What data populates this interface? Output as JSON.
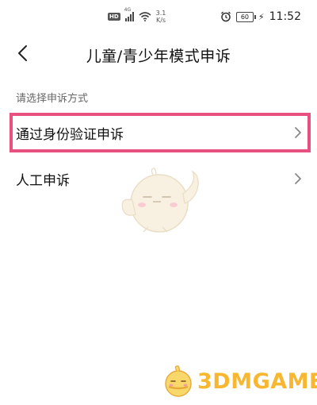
{
  "status_bar": {
    "hd_badge": "HD",
    "network_tag": "4G",
    "speed_value": "3.1",
    "speed_unit": "K/s",
    "battery_level": "60",
    "time": "11:52"
  },
  "nav": {
    "title": "儿童/青少年模式申诉",
    "back_icon": "chevron-left-icon"
  },
  "section": {
    "caption": "请选择申诉方式"
  },
  "options": [
    {
      "label": "通过身份验证申诉",
      "icon": "chevron-right-icon",
      "highlighted": true
    },
    {
      "label": "人工申诉",
      "icon": "chevron-right-icon",
      "highlighted": false
    }
  ],
  "watermark": {
    "text": "3DMGAME"
  },
  "colors": {
    "highlight_border": "#e8517f",
    "watermark": "#f7b731"
  }
}
